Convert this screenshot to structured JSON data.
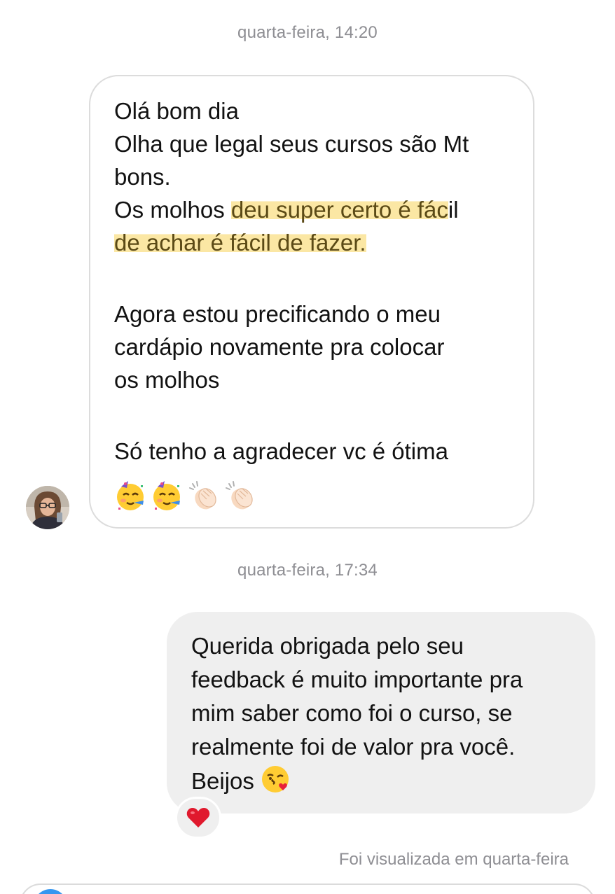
{
  "thread": {
    "timestamp_1": "quarta-feira, 14:20",
    "timestamp_2": "quarta-feira, 17:34",
    "seen_status": "Foi visualizada em quarta-feira"
  },
  "incoming_message": {
    "line_1": "Olá bom dia",
    "line_2": "Olha que legal seus cursos são Mt",
    "line_3": "bons.",
    "line_4_pre": "Os molhos ",
    "line_4_highlight": "deu super certo é fác",
    "line_4_post": "il",
    "line_5_highlight": "de achar é fácil de fazer.",
    "line_6": "Agora estou precificando o meu",
    "line_7": "cardápio novamente pra colocar",
    "line_8": "os molhos",
    "line_9": "Só tenho a agradecer vc é ótima",
    "emojis": [
      "partying-face-emoji",
      "partying-face-emoji",
      "clapping-hands-emoji",
      "clapping-hands-emoji"
    ]
  },
  "outgoing_message": {
    "line_1": "Querida obrigada pelo seu",
    "line_2": "feedback é muito importante pra",
    "line_3": "mim saber como foi o curso, se",
    "line_4": "realmente foi de valor pra você.",
    "line_5": "Beijos",
    "emoji": "face-blowing-kiss-emoji",
    "reaction": "red-heart-icon"
  },
  "colors": {
    "highlight": "#fbe7a4",
    "incoming_border": "#dcdcdc",
    "outgoing_bg": "#efefef",
    "meta_text": "#8e8e93",
    "heart": "#e0192d"
  }
}
